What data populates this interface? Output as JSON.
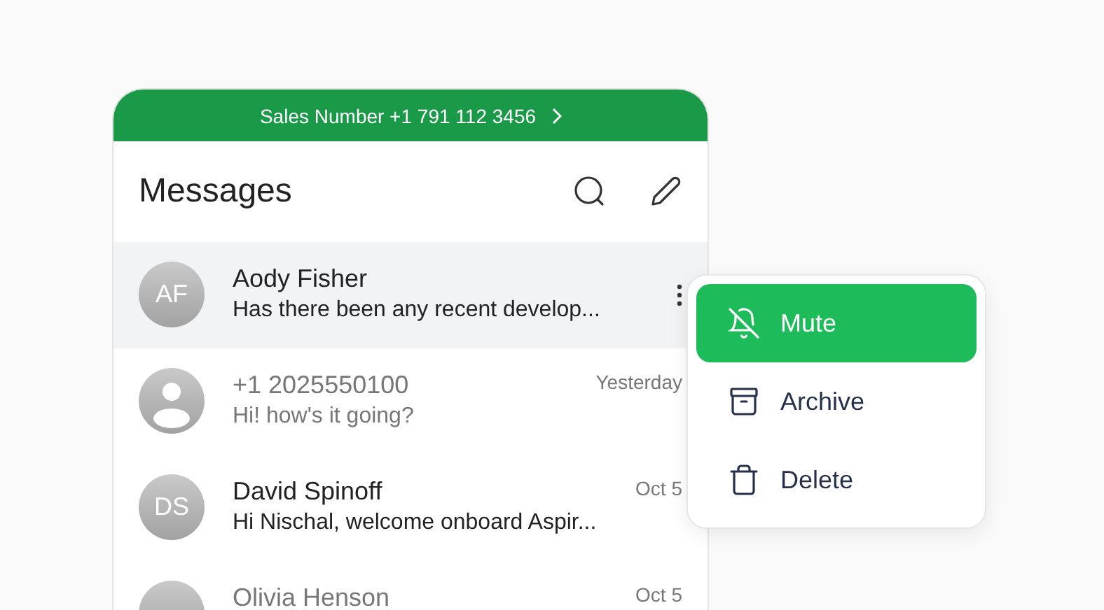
{
  "banner": {
    "text": "Sales Number +1 791 112 3456"
  },
  "header": {
    "title": "Messages"
  },
  "conversations": [
    {
      "kind": "initials",
      "initials": "AF",
      "name": "Aody Fisher",
      "preview": "Has there been any recent develop...",
      "selected": true,
      "unread": true
    },
    {
      "kind": "person",
      "name": "+1 2025550100",
      "preview": "Hi! how's it going?",
      "time": "Yesterday",
      "selected": false,
      "unread": false
    },
    {
      "kind": "initials",
      "initials": "DS",
      "name": "David Spinoff",
      "preview": "Hi Nischal, welcome onboard Aspir...",
      "time": "Oct 5",
      "selected": false,
      "unread": true
    },
    {
      "kind": "blank",
      "name": "Olivia Henson",
      "time": "Oct 5",
      "selected": false,
      "unread": false
    }
  ],
  "menu": [
    {
      "kind": "mute",
      "label": "Mute",
      "selected": true
    },
    {
      "kind": "archive",
      "label": "Archive",
      "selected": false
    },
    {
      "kind": "delete",
      "label": "Delete",
      "selected": false
    }
  ]
}
